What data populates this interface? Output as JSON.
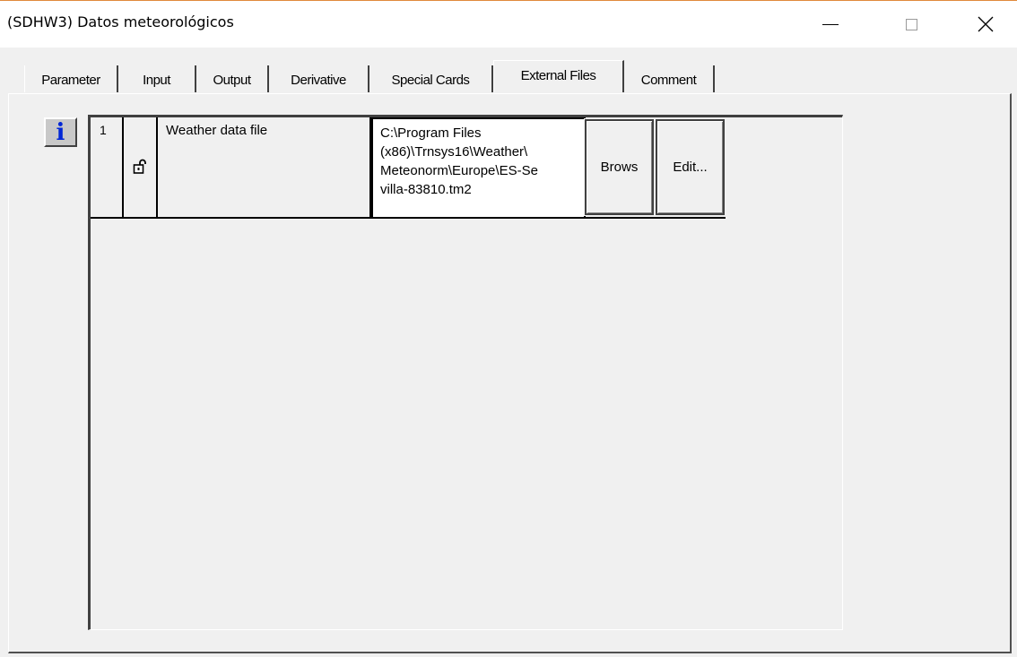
{
  "window": {
    "title": "(SDHW3) Datos meteorológicos"
  },
  "tabs": [
    {
      "label": "Parameter",
      "active": false
    },
    {
      "label": "Input",
      "active": false
    },
    {
      "label": "Output",
      "active": false
    },
    {
      "label": "Derivative",
      "active": false
    },
    {
      "label": "Special Cards",
      "active": false
    },
    {
      "label": "External Files",
      "active": true
    },
    {
      "label": "Comment",
      "active": false
    }
  ],
  "external_files": {
    "rows": [
      {
        "index": "1",
        "lock": "unlocked-padlock-icon",
        "label": "Weather data file",
        "path_lines": [
          "C:\\Program Files",
          "(x86)\\Trnsys16\\Weather\\",
          "Meteonorm\\Europe\\ES-Se",
          "villa-83810.tm2"
        ],
        "browse_label": "Brows",
        "edit_label": "Edit..."
      }
    ]
  },
  "info_button": {
    "glyph": "i",
    "color": "#0026d6"
  }
}
